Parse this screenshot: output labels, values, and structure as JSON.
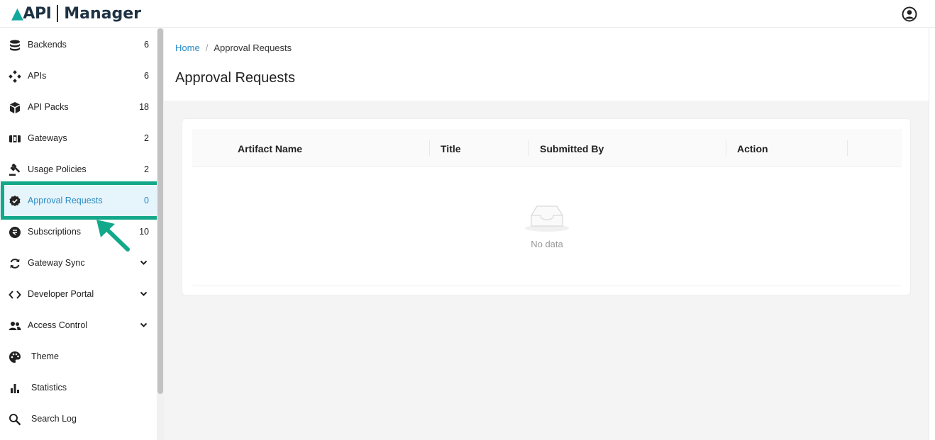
{
  "header": {
    "logo_api": "API",
    "logo_manager": "Manager"
  },
  "sidebar": {
    "items": [
      {
        "label": "Backends",
        "count": "6",
        "icon": "database-icon"
      },
      {
        "label": "APIs",
        "count": "6",
        "icon": "api-diamond-icon"
      },
      {
        "label": "API Packs",
        "count": "18",
        "icon": "package-icon"
      },
      {
        "label": "Gateways",
        "count": "2",
        "icon": "gateway-icon"
      },
      {
        "label": "Usage Policies",
        "count": "2",
        "icon": "gavel-icon"
      },
      {
        "label": "Approval Requests",
        "count": "0",
        "icon": "verified-badge-icon",
        "active": true
      },
      {
        "label": "Subscriptions",
        "count": "10",
        "icon": "subscription-icon"
      },
      {
        "label": "Gateway Sync",
        "icon": "sync-icon",
        "expandable": true
      },
      {
        "label": "Developer Portal",
        "icon": "code-icon",
        "expandable": true
      },
      {
        "label": "Access Control",
        "icon": "people-icon",
        "expandable": true
      },
      {
        "label": "Theme",
        "icon": "palette-icon"
      },
      {
        "label": "Statistics",
        "icon": "bar-chart-icon"
      },
      {
        "label": "Search Log",
        "icon": "search-icon"
      }
    ]
  },
  "breadcrumb": {
    "home": "Home",
    "separator": "/",
    "current": "Approval Requests"
  },
  "page": {
    "title": "Approval Requests"
  },
  "table": {
    "columns": [
      "Artifact Name",
      "Title",
      "Submitted By",
      "Action"
    ],
    "rows": [],
    "empty_text": "No data"
  },
  "colors": {
    "accent": "#2a8bc4",
    "highlight": "#13a88a",
    "active_bg": "#e6f4fb"
  }
}
